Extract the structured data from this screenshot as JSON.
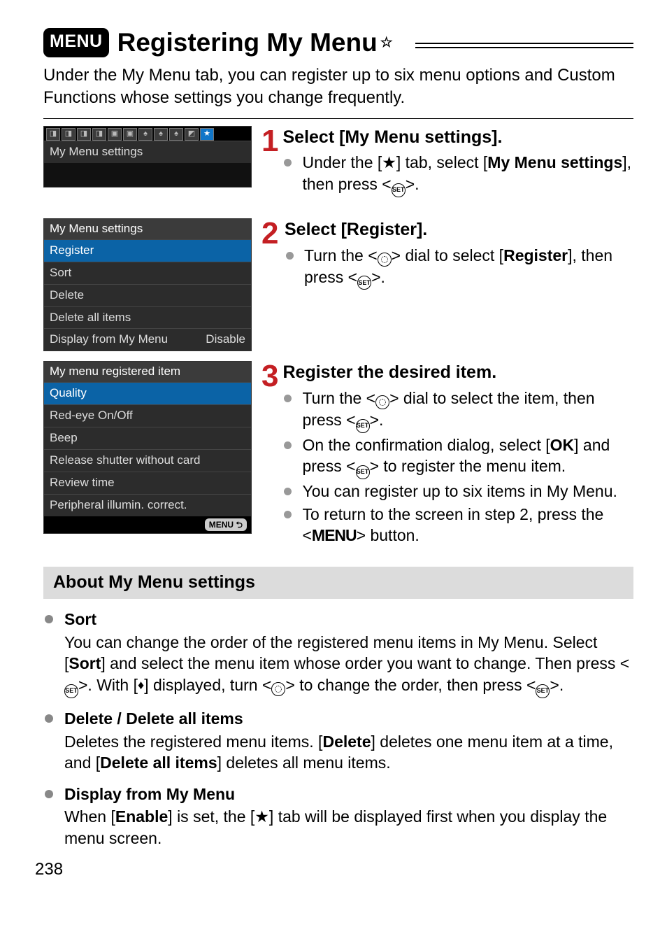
{
  "title_badge": "MENU",
  "title": "Registering My Menu",
  "title_star": "☆",
  "intro": "Under the My Menu tab, you can register up to six menu options and Custom Functions whose settings you change frequently.",
  "shot1": {
    "header": "My Menu settings"
  },
  "shot2": {
    "header": "My Menu settings",
    "items": [
      "Register",
      "Sort",
      "Delete",
      "Delete all items"
    ],
    "display_label": "Display from My Menu",
    "display_value": "Disable"
  },
  "shot3": {
    "header": "My menu registered item",
    "items": [
      "Quality",
      "Red-eye On/Off",
      "Beep",
      "Release shutter without card",
      "Review time",
      "Peripheral illumin. correct."
    ],
    "footer": "MENU"
  },
  "steps": [
    {
      "num": "1",
      "title": "Select [My Menu settings].",
      "bullets": [
        {
          "parts": [
            "Under the [",
            "★",
            "] tab, select [",
            "My Menu settings",
            "], then press <",
            "SET_ICON",
            ">."
          ]
        }
      ]
    },
    {
      "num": "2",
      "title": "Select [Register].",
      "bullets": [
        {
          "parts": [
            "Turn the <",
            "DIAL_ICON",
            "> dial to select [",
            "Register",
            "], then press <",
            "SET_ICON",
            ">."
          ]
        }
      ]
    },
    {
      "num": "3",
      "title": "Register the desired item.",
      "bullets": [
        {
          "parts": [
            "Turn the <",
            "DIAL_ICON",
            "> dial to select the item, then press <",
            "SET_ICON",
            ">."
          ]
        },
        {
          "parts": [
            "On the confirmation dialog, select [",
            "OK",
            "] and press <",
            "SET_ICON",
            "> to register the menu item."
          ]
        },
        {
          "parts": [
            "You can register up to six items in My Menu."
          ]
        },
        {
          "parts": [
            "To return to the screen in step 2, press the <",
            "MENU_WORD",
            "> button."
          ]
        }
      ]
    }
  ],
  "about_header": "About My Menu settings",
  "about": [
    {
      "term": "Sort",
      "body_parts": [
        "You can change the order of the registered menu items in My Menu. Select [",
        "Sort",
        "] and select the menu item whose order you want to change. Then press <",
        "SET_ICON",
        ">. With [",
        "UPDOWN",
        "] displayed, turn <",
        "DIAL_ICON",
        "> to change the order, then press <",
        "SET_ICON",
        ">."
      ]
    },
    {
      "term": "Delete / Delete all items",
      "body_parts": [
        "Deletes the registered menu items. [",
        "Delete",
        "] deletes one menu item at a time, and [",
        "Delete all items",
        "] deletes all menu items."
      ]
    },
    {
      "term": "Display from My Menu",
      "body_parts": [
        "When [",
        "Enable",
        "] is set, the [",
        "★",
        "] tab will be displayed first when you display the menu screen."
      ]
    }
  ],
  "page_number": "238"
}
